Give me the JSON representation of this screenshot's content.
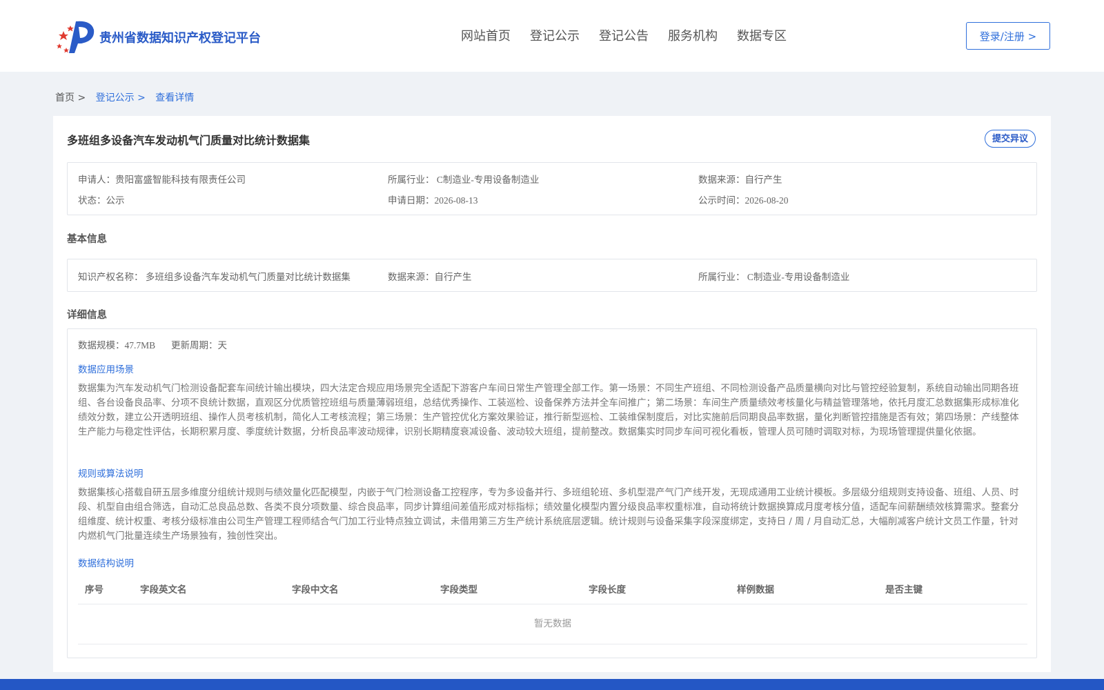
{
  "header": {
    "brand": "贵州省数据知识产权登记平台",
    "nav": [
      "网站首页",
      "登记公示",
      "登记公告",
      "服务机构",
      "数据专区"
    ],
    "login_label": "登录/注册 >"
  },
  "breadcrumb": {
    "home": "首页 >",
    "level1": "登记公示 >",
    "current": "查看详情"
  },
  "detail": {
    "title": "多班组多设备汽车发动机气门质量对比统计数据集",
    "objection_label": "提交异议",
    "summary": {
      "applicant": "申请人：贵阳富盛智能科技有限责任公司",
      "industry": "所属行业： C制造业-专用设备制造业",
      "source": "数据来源：自行产生",
      "status": "状态：公示",
      "apply_date": "申请日期：2026-08-13",
      "publish_time": "公示时间：2026-08-20"
    },
    "basic": {
      "section_title": "基本信息",
      "ip_name": "知识产权名称： 多班组多设备汽车发动机气门质量对比统计数据集",
      "source": "数据来源：自行产生",
      "industry": "所属行业： C制造业-专用设备制造业"
    },
    "details": {
      "section_title": "详细信息",
      "scale": "数据规模：47.7MB",
      "update_cycle": "更新周期：天",
      "scenario_title": "数据应用场景",
      "scenario_text": "数据集为汽车发动机气门检测设备配套车间统计输出模块，四大法定合规应用场景完全适配下游客户车间日常生产管理全部工作。第一场景：不同生产班组、不同检测设备产品质量横向对比与管控经验复制，系统自动输出同期各班组、各台设备良品率、分项不良统计数据，直观区分优质管控班组与质量薄弱班组，总结优秀操作、工装巡检、设备保养方法并全车间推广；第二场景：车间生产质量绩效考核量化与精益管理落地，依托月度汇总数据集形成标准化绩效分数，建立公开透明班组、操作人员考核机制，简化人工考核流程；第三场景：生产管控优化方案效果验证，推行新型巡检、工装维保制度后，对比实施前后同期良品率数据，量化判断管控措施是否有效；第四场景：产线整体生产能力与稳定性评估，长期积累月度、季度统计数据，分析良品率波动规律，识别长期精度衰减设备、波动较大班组，提前整改。数据集实时同步车间可视化看板，管理人员可随时调取对标，为现场管理提供量化依据。",
      "algorithm_title": "规则或算法说明",
      "algorithm_text": "数据集核心搭载自研五层多维度分组统计规则与绩效量化匹配模型，内嵌于气门检测设备工控程序，专为多设备并行、多班组轮班、多机型混产气门产线开发，无现成通用工业统计模板。多层级分组规则支持设备、班组、人员、时段、机型自由组合筛选，自动汇总良品总数、各类不良分项数量、综合良品率，同步计算组间差值形成对标指标；绩效量化模型内置分级良品率权重标准，自动将统计数据换算成月度考核分值，适配车间薪酬绩效核算需求。整套分组维度、统计权重、考核分级标准由公司生产管理工程师结合气门加工行业特点独立调试，未借用第三方生产统计系统底层逻辑。统计规则与设备采集字段深度绑定，支持日 / 周 / 月自动汇总，大幅削减客户统计文员工作量，针对内燃机气门批量连续生产场景独有，独创性突出。",
      "structure_title": "数据结构说明",
      "table_headers": [
        "序号",
        "字段英文名",
        "字段中文名",
        "字段类型",
        "字段长度",
        "样例数据",
        "是否主键"
      ],
      "empty_text": "暂无数据"
    }
  },
  "colors": {
    "brand_blue": "#2a5bc7",
    "link_blue": "#2f6fdb",
    "footer_blue": "#2457c5",
    "page_bg": "#eff2f6"
  }
}
